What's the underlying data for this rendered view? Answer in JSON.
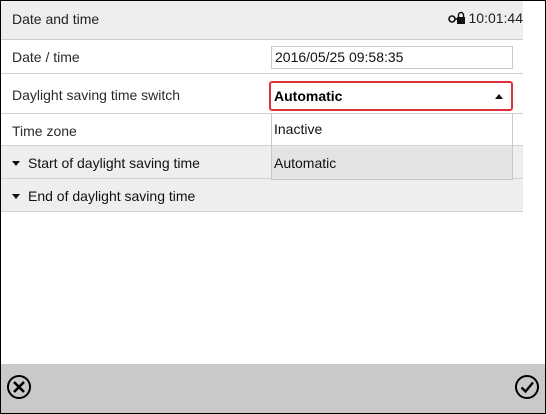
{
  "header": {
    "title": "Date and time",
    "time": "10:01:44"
  },
  "rows": {
    "date_time": {
      "label": "Date / time",
      "value": "2016/05/25 09:58:35"
    },
    "dst_switch": {
      "label": "Daylight saving time switch",
      "value": "Automatic"
    },
    "time_zone": {
      "label": "Time zone"
    },
    "start_dst": {
      "label": "Start of daylight saving time"
    },
    "end_dst": {
      "label": "End of daylight saving time"
    }
  },
  "dropdown_options": [
    {
      "label": "Inactive",
      "selected": false
    },
    {
      "label": "Automatic",
      "selected": true
    }
  ],
  "icons": {
    "lock": "lock-icon",
    "cancel": "cancel-x-icon",
    "confirm": "confirm-check-icon",
    "dropdown": "chevron-up-icon",
    "expand": "caret-down-icon"
  }
}
